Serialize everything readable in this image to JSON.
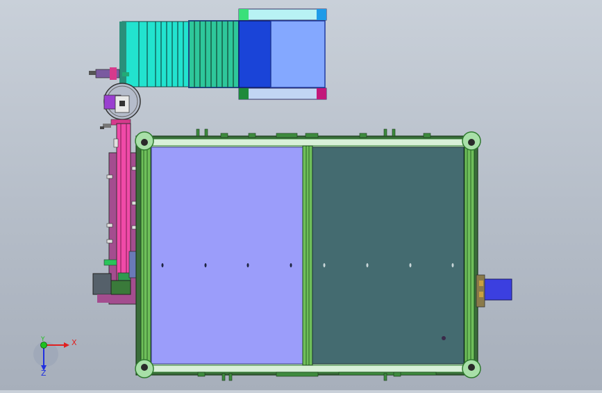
{
  "viewport": {
    "background_top": "#c9d0d9",
    "background_bottom": "#a7afbb"
  },
  "triad": {
    "x_label": "X",
    "y_label": "Y",
    "z_label": "Z",
    "x_color": "#e02020",
    "y_color": "#20c020",
    "z_color": "#2030e0"
  },
  "colors": {
    "frame_green": "#2f7a2f",
    "table_left": "#9b9dfa",
    "table_right": "#446b70",
    "conveyor_cyan": "#22e3cf",
    "blue_box": "#1a44d8",
    "light_blue": "#84a8ff",
    "slide_rail": "#d63a8c",
    "motor_block": "#a44d8f"
  }
}
